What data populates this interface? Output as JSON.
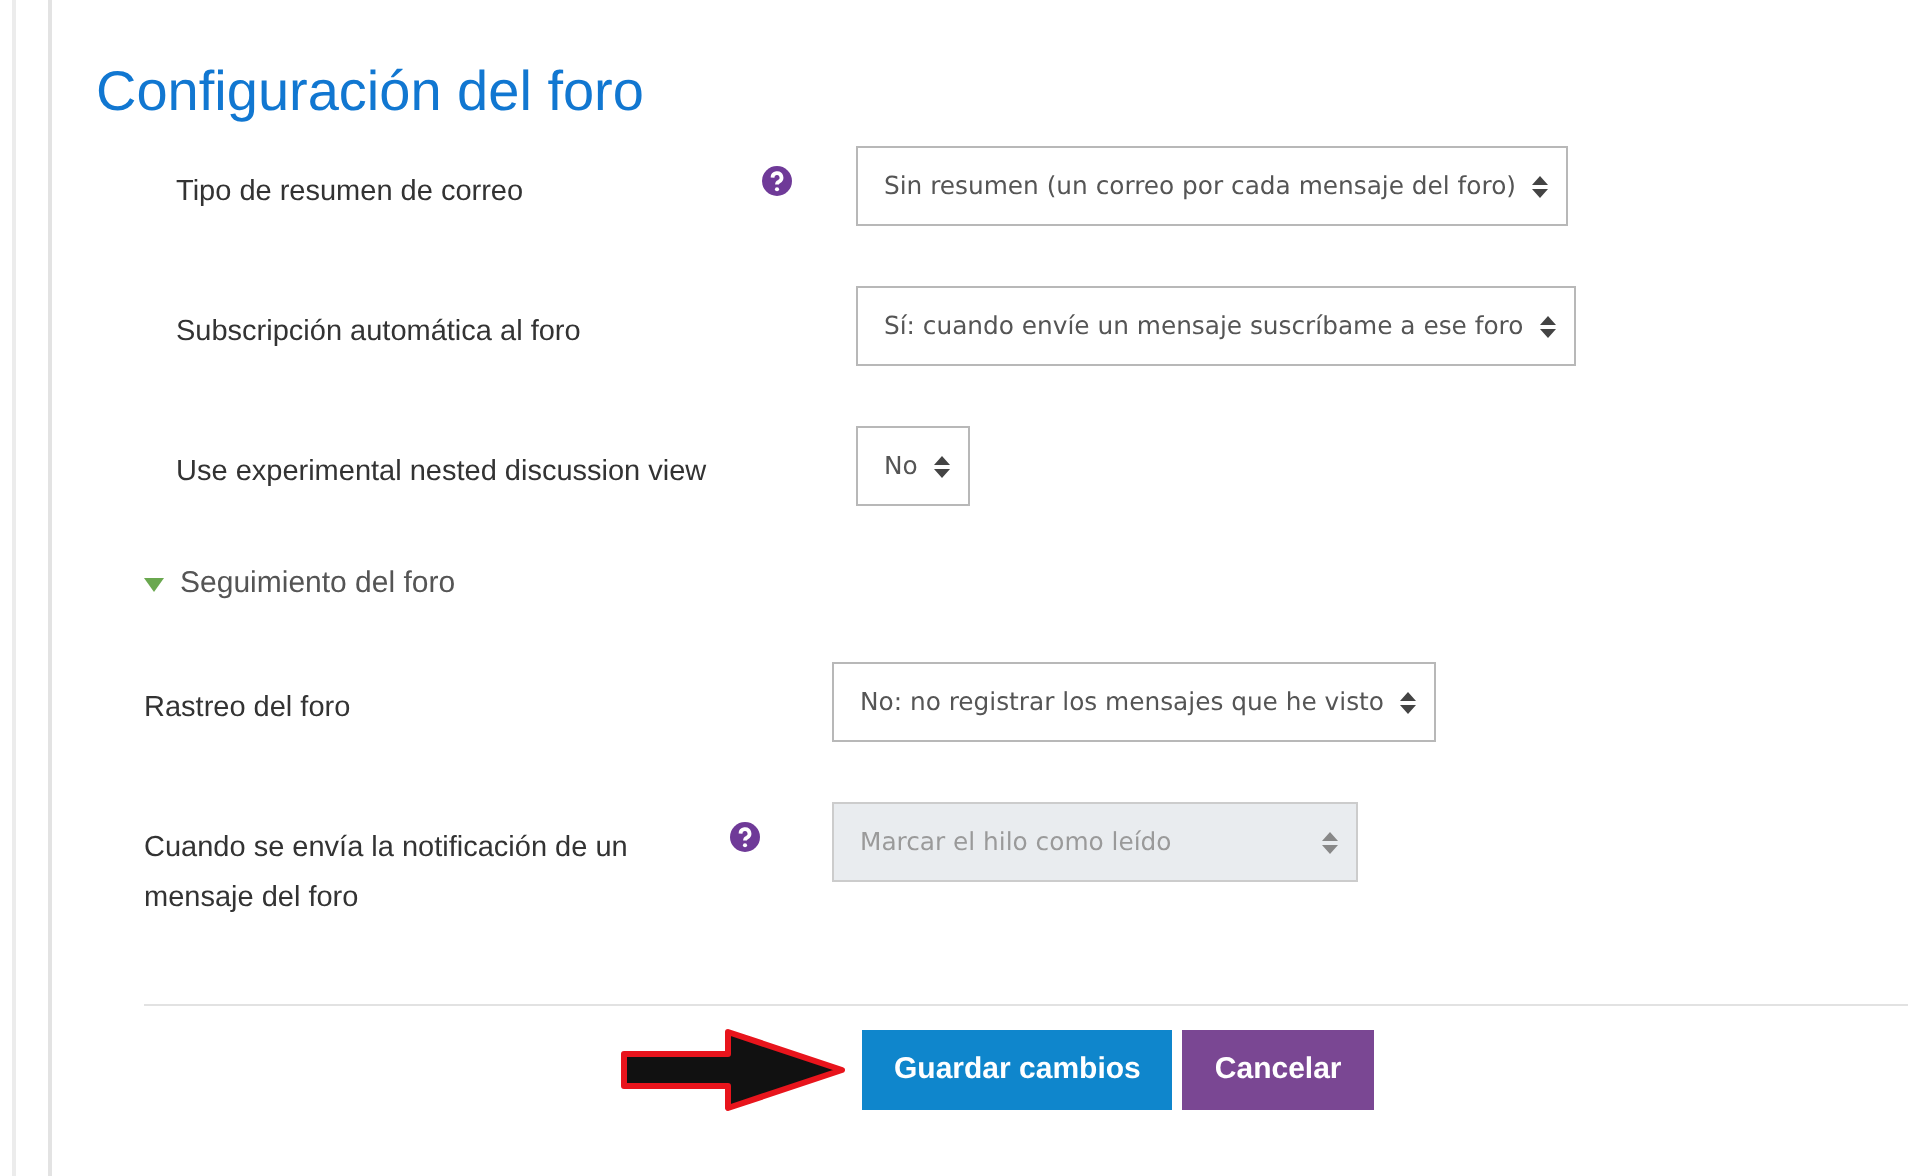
{
  "title": "Configuración del foro",
  "fields": [
    {
      "label": "Tipo de resumen de correo",
      "help": true,
      "value": "Sin resumen (un correo por cada mensaje del foro)",
      "disabled": false
    },
    {
      "label": "Subscripción automática al foro",
      "help": false,
      "value": "Sí: cuando envíe un mensaje suscríbame a ese foro",
      "disabled": false
    },
    {
      "label": "Use experimental nested discussion view",
      "help": false,
      "value": "No",
      "disabled": false
    }
  ],
  "subsection": {
    "label": "Seguimiento del foro",
    "expanded": true,
    "fields": [
      {
        "label": "Rastreo del foro",
        "help": false,
        "value": "No: no registrar los mensajes que he visto",
        "disabled": false
      },
      {
        "label": "Cuando se envía la notificación de un mensaje del foro",
        "help": true,
        "value": "Marcar el hilo como leído",
        "disabled": true
      }
    ]
  },
  "buttons": [
    {
      "label": "Guardar cambios",
      "kind": "primary"
    },
    {
      "label": "Cancelar",
      "kind": "secondary"
    }
  ]
}
